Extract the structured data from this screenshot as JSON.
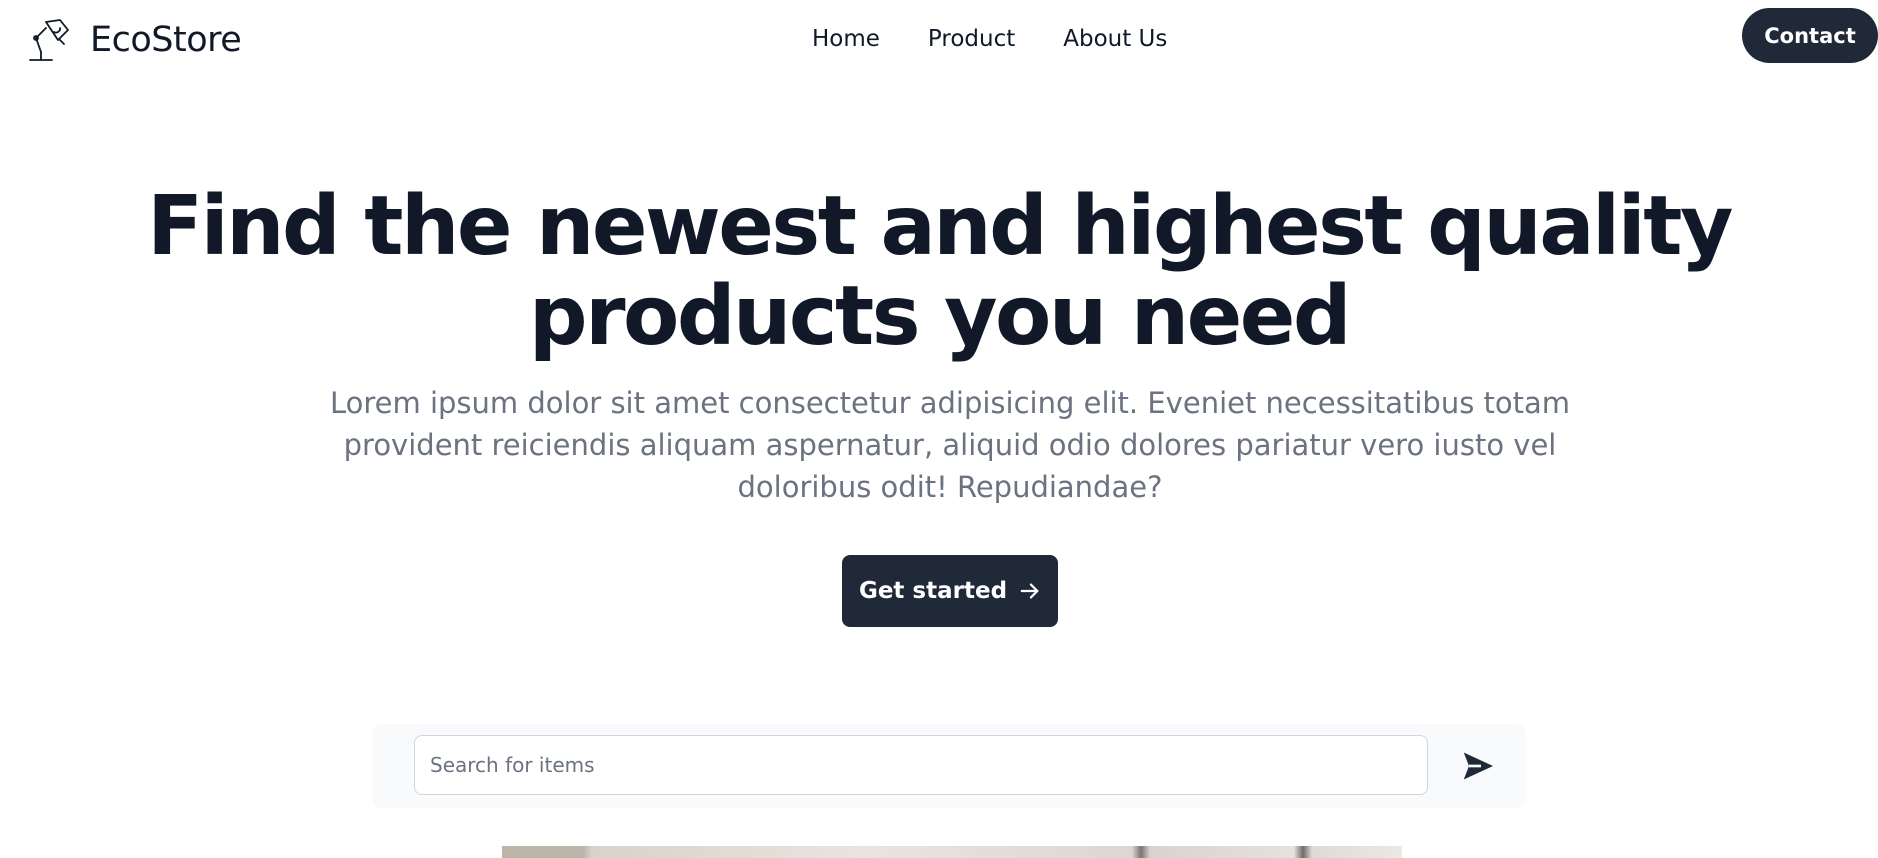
{
  "header": {
    "brand": "EcoStore",
    "logo_icon": "desk-lamp-icon",
    "nav": [
      "Home",
      "Product",
      "About Us"
    ],
    "contact_label": "Contact"
  },
  "hero": {
    "title_line1": "Find the newest and highest quality",
    "title_line2": "products you need",
    "description": "Lorem ipsum dolor sit amet consectetur adipisicing elit. Eveniet necessitatibus totam provident reiciendis aliquam aspernatur, aliquid odio dolores pariatur vero iusto vel doloribus odit! Repudiandae?",
    "cta_label": "Get started",
    "cta_icon": "arrow-right-icon"
  },
  "search": {
    "placeholder": "Search for items",
    "value": "",
    "submit_icon": "send-icon"
  },
  "colors": {
    "text_primary": "#111827",
    "text_muted": "#6b7280",
    "button_dark": "#1f2937",
    "search_bg": "#f9fafb"
  }
}
